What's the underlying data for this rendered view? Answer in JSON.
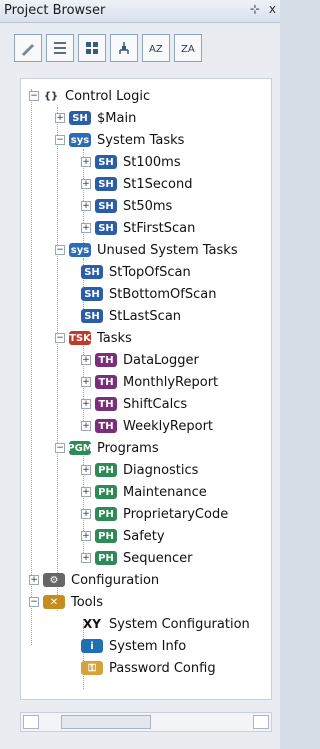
{
  "window": {
    "title": "Project Browser",
    "pin_icon": "pin-icon",
    "close_label": "x"
  },
  "toolbar": {
    "buttons": [
      {
        "name": "pencil-icon"
      },
      {
        "name": "list-icon"
      },
      {
        "name": "grid-icon"
      },
      {
        "name": "network-icon"
      },
      {
        "name": "sort-az-icon"
      },
      {
        "name": "sort-za-icon"
      }
    ]
  },
  "tree": {
    "root": {
      "label": "Control Logic",
      "icon": "curly-icon"
    },
    "nodes": [
      {
        "label": "$Main",
        "type": "sh"
      },
      {
        "label": "System Tasks",
        "type": "sys"
      },
      {
        "label": "St100ms",
        "type": "sh"
      },
      {
        "label": "St1Second",
        "type": "sh"
      },
      {
        "label": "St50ms",
        "type": "sh"
      },
      {
        "label": "StFirstScan",
        "type": "sh"
      },
      {
        "label": "Unused System Tasks",
        "type": "sys"
      },
      {
        "label": "StTopOfScan",
        "type": "sh"
      },
      {
        "label": "StBottomOfScan",
        "type": "sh"
      },
      {
        "label": "StLastScan",
        "type": "sh"
      },
      {
        "label": "Tasks",
        "type": "tasks"
      },
      {
        "label": "DataLogger",
        "type": "th"
      },
      {
        "label": "MonthlyReport",
        "type": "th"
      },
      {
        "label": "ShiftCalcs",
        "type": "th"
      },
      {
        "label": "WeeklyReport",
        "type": "th"
      },
      {
        "label": "Programs",
        "type": "ph"
      },
      {
        "label": "Diagnostics",
        "type": "ph"
      },
      {
        "label": "Maintenance",
        "type": "ph"
      },
      {
        "label": "ProprietaryCode",
        "type": "ph"
      },
      {
        "label": "Safety",
        "type": "ph"
      },
      {
        "label": "Sequencer",
        "type": "ph"
      },
      {
        "label": "Configuration",
        "type": "config"
      },
      {
        "label": "Tools",
        "type": "tools"
      },
      {
        "label": "System Configuration",
        "type": "tools"
      },
      {
        "label": "System Info",
        "type": "tools"
      },
      {
        "label": "Password Config",
        "type": "tools"
      }
    ]
  }
}
